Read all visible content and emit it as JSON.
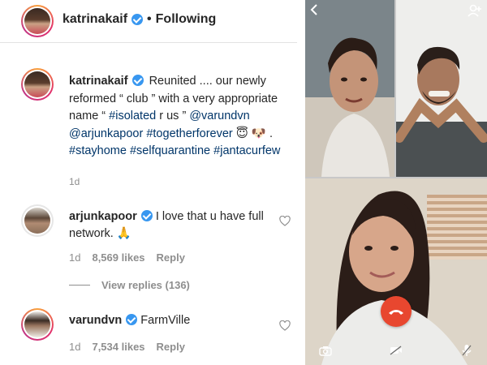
{
  "post": {
    "author": "katrinakaif",
    "follow_state": "Following",
    "separator": "•",
    "caption": {
      "user": "katrinakaif",
      "segments": [
        {
          "text": " Reunited .... our newly reformed “ club ” with a very appropriate name “ ",
          "type": "text"
        },
        {
          "text": "#isolated",
          "type": "tag"
        },
        {
          "text": " r us ” ",
          "type": "text"
        },
        {
          "text": "@varundvn",
          "type": "tag"
        },
        {
          "text": " ",
          "type": "text"
        },
        {
          "text": "@arjunkapoor",
          "type": "tag"
        },
        {
          "text": " ",
          "type": "text"
        },
        {
          "text": "#togetherforever",
          "type": "tag"
        },
        {
          "text": " 😇 🐶 . ",
          "type": "text"
        },
        {
          "text": "#stayhome",
          "type": "tag"
        },
        {
          "text": " ",
          "type": "text"
        },
        {
          "text": "#selfquarantine",
          "type": "tag"
        },
        {
          "text": " ",
          "type": "text"
        },
        {
          "text": "#jantacurfew",
          "type": "tag"
        }
      ]
    },
    "age": "1d"
  },
  "comments": [
    {
      "user": "arjunkapoor",
      "text": " I love that u have full network. 🙏",
      "age": "1d",
      "likes": "8,569 likes",
      "reply": "Reply",
      "view_replies": "View replies (136)"
    },
    {
      "user": "varundvn",
      "text": " FarmVille",
      "age": "1d",
      "likes": "7,534 likes",
      "reply": "Reply"
    }
  ],
  "video_call": {
    "participants": [
      "varundvn",
      "arjunkapoor",
      "katrinakaif"
    ],
    "icons": [
      "back-icon",
      "add-person-icon",
      "camera-icon",
      "end-call-icon",
      "video-toggle-icon",
      "mic-icon"
    ],
    "end_call_color": "#e8472f"
  },
  "colors": {
    "verified": "#3897f0",
    "link": "#003569",
    "muted": "#8e8e8e"
  }
}
